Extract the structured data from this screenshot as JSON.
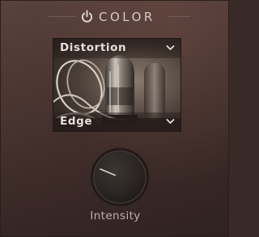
{
  "module": {
    "title": "COLOR",
    "power": {
      "icon": "power-icon",
      "enabled": true
    }
  },
  "preview": {
    "image": "vacuum-tube-photo",
    "type_select": {
      "value": "Distortion",
      "icon": "chevron-down-icon"
    },
    "variant_select": {
      "value": "Edge",
      "icon": "chevron-down-icon"
    }
  },
  "knob": {
    "label": "Intensity",
    "value": 0.25
  },
  "colors": {
    "background": "#4a3531",
    "text": "#d6cac6",
    "knob": "#2b2624"
  }
}
